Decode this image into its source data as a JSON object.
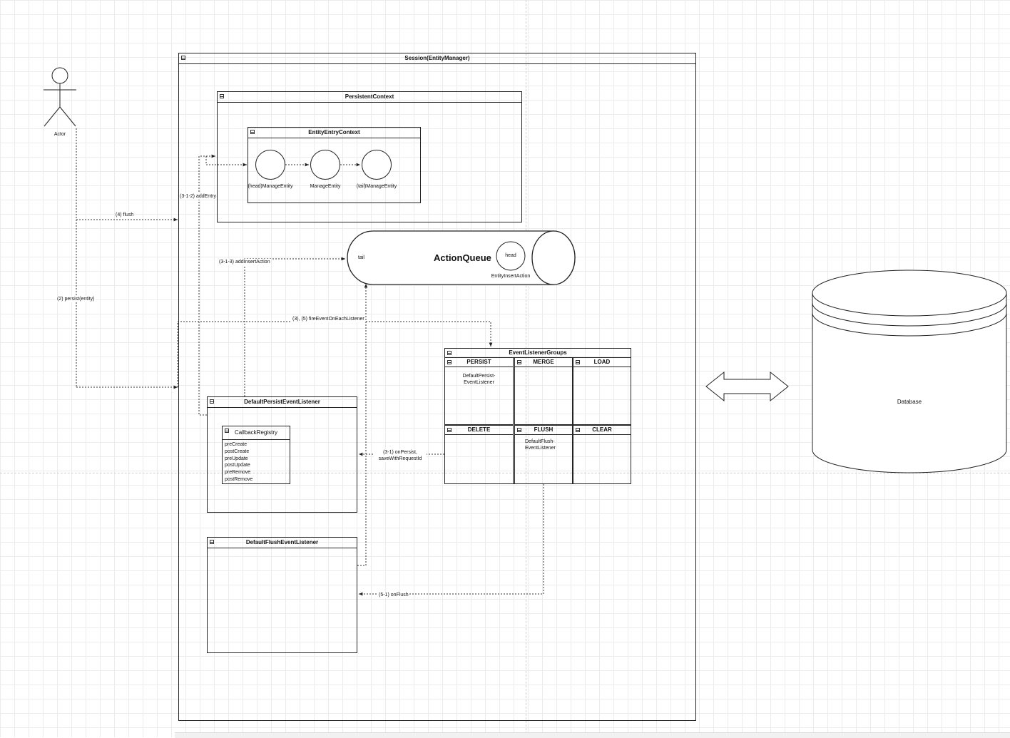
{
  "actor": {
    "label": "Actor"
  },
  "session": {
    "title": "Session(EntityManager)"
  },
  "persistent_context": {
    "title": "PersistentContext",
    "entity_entry_context": {
      "title": "EntityEntryContext",
      "entries": [
        "(head)ManageEntity",
        "ManageEntity",
        "(tail)ManageEntity"
      ]
    }
  },
  "action_queue": {
    "title": "ActionQueue",
    "tail_label": "tail",
    "head_label": "head",
    "action_label": "EntityInsertAction"
  },
  "event_listener_groups": {
    "title": "EventListenerGroups",
    "cells": [
      {
        "title": "PERSIST",
        "body": [
          "DefaultPersist-",
          "EventListener"
        ]
      },
      {
        "title": "MERGE",
        "body": []
      },
      {
        "title": "LOAD",
        "body": []
      },
      {
        "title": "DELETE",
        "body": []
      },
      {
        "title": "FLUSH",
        "body": [
          "DefaultFlush-",
          "EventListener"
        ]
      },
      {
        "title": "CLEAR",
        "body": []
      }
    ]
  },
  "persist_listener": {
    "title": "DefaultPersistEventListener",
    "callback_registry": {
      "title": "CallbackRegistry",
      "items": [
        "preCreate",
        "postCreate",
        "preUpdate",
        "postUpdate",
        "preRemove",
        "postRemove"
      ]
    }
  },
  "flush_listener": {
    "title": "DefaultFlushEventListener"
  },
  "database": {
    "label": "Database"
  },
  "edge_labels": {
    "flush": "(4) flush",
    "persist": "(2) persist(entity)",
    "add_entry": "(3-1-2) addEntry",
    "add_insert_action": "(3-1-3) addInsertAction",
    "fire_event": "(3), (5) fireEventOnEachListener",
    "on_persist": [
      "(3-1) onPersist,",
      "saveWithRequestId"
    ],
    "on_flush": "(5-1) onFlush"
  }
}
